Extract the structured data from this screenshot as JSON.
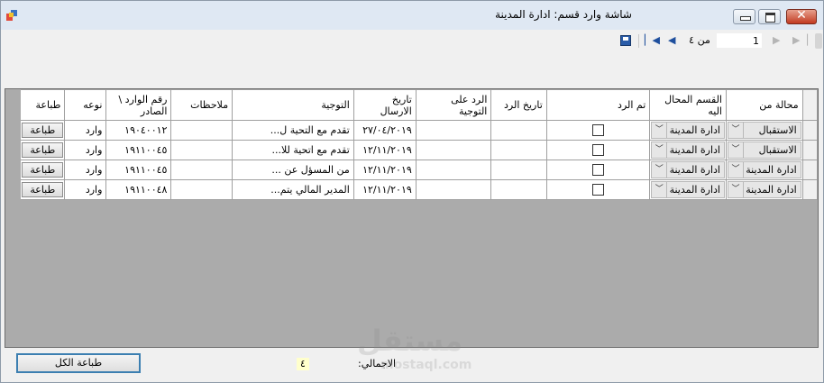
{
  "window": {
    "title": "شاشة وارد قسم: ادارة المدينة",
    "close_symbol": "✕"
  },
  "navigator": {
    "position": "1",
    "of_label": "من ٤",
    "icons": [
      "save-icon",
      "first-icon",
      "prev-icon",
      "next-icon",
      "last-icon"
    ]
  },
  "grid": {
    "columns": [
      "محالة من",
      "القسم المحال اليه",
      "تم الرد",
      "تاريخ الرد",
      "الرد على التوجية",
      "تاريخ الارسال",
      "التوجية",
      "ملاحظات",
      "رقم الوارد \\ الصادر",
      "نوعه",
      "طباعة"
    ],
    "rows": [
      {
        "from": "الاستقبال",
        "to_dept": "ادارة المدينة",
        "replied": false,
        "reply_date": "",
        "reply": "",
        "send_date": "٢٧/٠٤/٢٠١٩",
        "direction": "تقدم مع التحية ل...",
        "notes": "",
        "number": "١٩٠٤٠٠١٢",
        "type": "وارد",
        "print": "طباعة"
      },
      {
        "from": "الاستقبال",
        "to_dept": "ادارة المدينة",
        "replied": false,
        "reply_date": "",
        "reply": "",
        "send_date": "١٢/١١/٢٠١٩",
        "direction": "تقدم مع اتحية للا...",
        "notes": "",
        "number": "١٩١١٠٠٤٥",
        "type": "وارد",
        "print": "طباعة"
      },
      {
        "from": "ادارة المدينة",
        "to_dept": "ادارة المدينة",
        "replied": false,
        "reply_date": "",
        "reply": "",
        "send_date": "١٢/١١/٢٠١٩",
        "direction": "من المسؤل عن ...",
        "notes": "",
        "number": "١٩١١٠٠٤٥",
        "type": "وارد",
        "print": "طباعة"
      },
      {
        "from": "ادارة المدينة",
        "to_dept": "ادارة المدينة",
        "replied": false,
        "reply_date": "",
        "reply": "",
        "send_date": "١٢/١١/٢٠١٩",
        "direction": "المدير المالي يتم...",
        "notes": "",
        "number": "١٩١١٠٠٤٨",
        "type": "وارد",
        "print": "طباعة"
      }
    ]
  },
  "footer": {
    "print_all_label": "طباعة الكل",
    "total_label": "الاجمالي:",
    "total_value": "٤"
  },
  "watermark": {
    "word": "مستقل",
    "url": "mostaql.com"
  },
  "colors": {
    "grid_background": "#ababab",
    "accent_border": "#3c7fb1",
    "total_highlight": "#ffffcc"
  }
}
